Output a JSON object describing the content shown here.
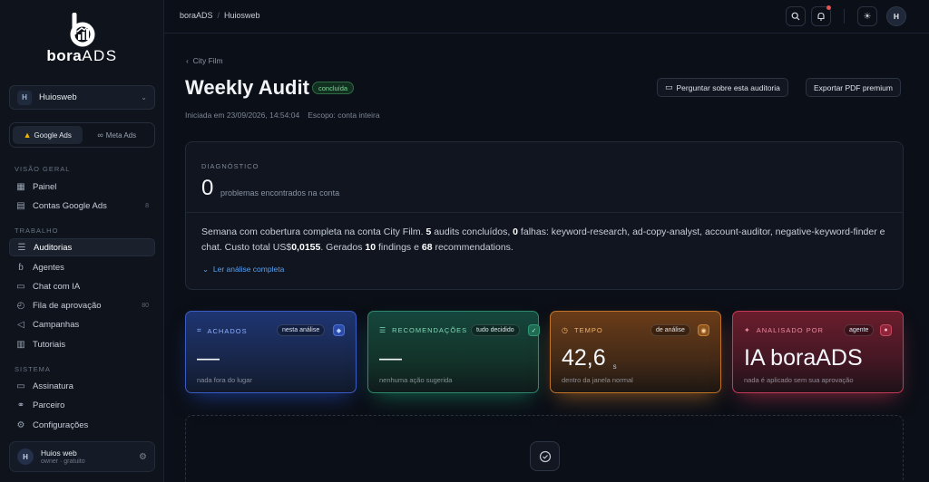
{
  "brand": {
    "name_bold": "bora",
    "name_light": "ADS"
  },
  "sidebar": {
    "account": {
      "initial": "H",
      "name": "Huiosweb"
    },
    "platforms": [
      {
        "label": "Google Ads",
        "icon": "google-ads-icon",
        "active": true
      },
      {
        "label": "Meta Ads",
        "icon": "meta-icon",
        "active": false
      }
    ],
    "sections": {
      "overview": "VISÃO GERAL",
      "work": "TRABALHO",
      "system": "SISTEMA"
    },
    "items": [
      {
        "label": "Painel",
        "icon": "dashboard-icon",
        "count": ""
      },
      {
        "label": "Contas Google Ads",
        "icon": "accounts-icon",
        "count": "8"
      },
      {
        "label": "Auditorias",
        "icon": "list-check-icon",
        "count": ""
      },
      {
        "label": "Agentes",
        "icon": "agents-icon",
        "count": ""
      },
      {
        "label": "Chat com IA",
        "icon": "chat-icon",
        "count": ""
      },
      {
        "label": "Fila de aprovação",
        "icon": "approval-icon",
        "count": "80"
      },
      {
        "label": "Campanhas",
        "icon": "megaphone-icon",
        "count": ""
      },
      {
        "label": "Tutoriais",
        "icon": "book-icon",
        "count": ""
      },
      {
        "label": "Assinatura",
        "icon": "card-icon",
        "count": ""
      },
      {
        "label": "Parceiro",
        "icon": "handshake-icon",
        "count": ""
      },
      {
        "label": "Configurações",
        "icon": "gear-icon",
        "count": ""
      }
    ],
    "user": {
      "initial": "H",
      "name": "Huios web",
      "role": "owner · gratuito"
    }
  },
  "topbar": {
    "breadcrumb": [
      "boraADS",
      "Huiosweb"
    ],
    "avatar_initial": "H"
  },
  "page": {
    "back_label": "City Film",
    "title": "Weekly Audit",
    "status": "concluída",
    "started": "Iniciada em 23/09/2026, 14:54:04",
    "scope": "Escopo: conta inteira",
    "ask_button": "Perguntar sobre esta auditoria",
    "export_button": "Exportar PDF premium"
  },
  "diagnostic": {
    "label": "DIAGNÓSTICO",
    "count": "0",
    "count_text": "problemas encontrados na conta",
    "summary": {
      "p1": "Semana com cobertura completa na conta City Film. ",
      "n_audits": "5",
      "p2": " audits concluídos, ",
      "n_fail": "0",
      "p3": " falhas: keyword-research, ad-copy-analyst, account-auditor, negative-keyword-finder e chat. Custo total US$",
      "cost": "0,0155",
      "p4": ". Gerados ",
      "n_findings": "10",
      "p5": " findings e ",
      "n_recs": "68",
      "p6": " recommendations."
    },
    "read_more": "Ler análise completa"
  },
  "stats": [
    {
      "label": "ACHADOS",
      "pill": "nesta análise",
      "value": "—",
      "unit": "",
      "sub": "nada fora do lugar",
      "color": "#3b5bc0"
    },
    {
      "label": "RECOMENDAÇÕES",
      "pill": "tudo decidido",
      "value": "—",
      "unit": "",
      "sub": "nenhuma ação sugerida",
      "color": "#2e8a6d"
    },
    {
      "label": "TEMPO",
      "pill": "de análise",
      "value": "42,6",
      "unit": "s",
      "sub": "dentro da janela normal",
      "color": "#c0732a"
    },
    {
      "label": "ANALISADO POR",
      "pill": "agente",
      "value": "IA boraADS",
      "unit": "",
      "sub": "nada é aplicado sem sua aprovação",
      "color": "#c53b55"
    }
  ]
}
